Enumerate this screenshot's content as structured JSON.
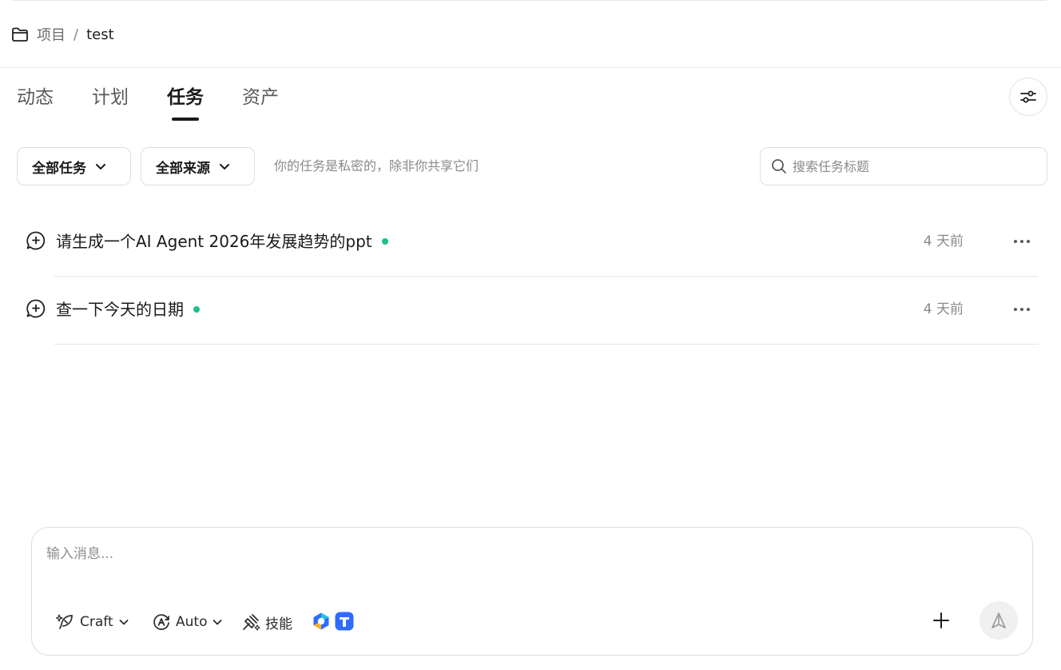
{
  "breadcrumb": {
    "root": "项目",
    "separator": "/",
    "current": "test"
  },
  "tabs": [
    {
      "label": "动态",
      "active": false
    },
    {
      "label": "计划",
      "active": false
    },
    {
      "label": "任务",
      "active": true
    },
    {
      "label": "资产",
      "active": false
    }
  ],
  "filters": {
    "task_filter": "全部任务",
    "source_filter": "全部来源"
  },
  "privacy_note": "你的任务是私密的，除非你共享它们",
  "search": {
    "placeholder": "搜索任务标题"
  },
  "tasks": [
    {
      "title": "请生成一个AI Agent 2026年发展趋势的ppt",
      "time": "4 天前",
      "status_color": "#1dbf8a"
    },
    {
      "title": "查一下今天的日期",
      "time": "4 天前",
      "status_color": "#1dbf8a"
    }
  ],
  "composer": {
    "placeholder": "输入消息...",
    "mode_label": "Craft",
    "model_label": "Auto",
    "skills_label": "技能"
  },
  "icons": {
    "breadcrumb": "folder-icon",
    "settings": "sliders-icon",
    "search": "search-icon",
    "task": "chat-plus-icon",
    "more": "more-horizontal-icon",
    "craft": "feather-icon",
    "auto": "auto-model-icon",
    "skills": "skills-icon",
    "add": "plus-icon",
    "send": "send-icon"
  },
  "colors": {
    "status_dot": "#1dbf8a",
    "app_blue": "#2f6bff"
  }
}
